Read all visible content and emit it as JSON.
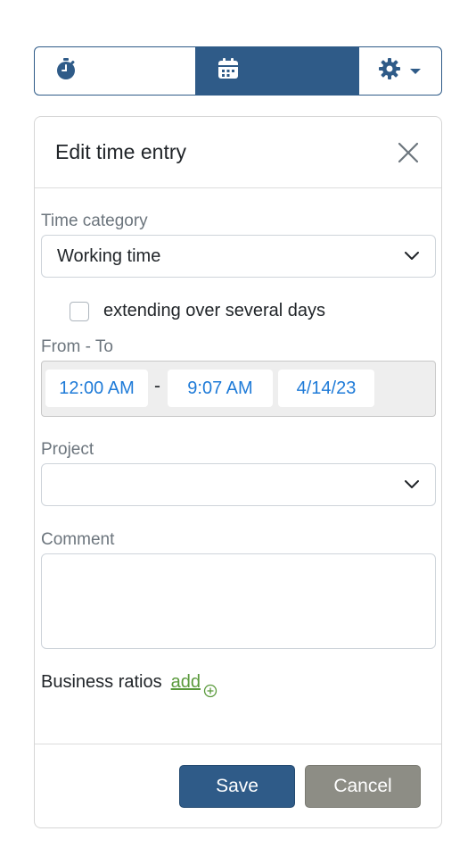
{
  "toolbar": {
    "icons": [
      "stopwatch-icon",
      "calendar-icon",
      "gear-icon",
      "caret-down-icon"
    ]
  },
  "dialog": {
    "title": "Edit time entry",
    "time_category": {
      "label": "Time category",
      "value": "Working time"
    },
    "multi_day": {
      "label": "extending over several days",
      "checked": false
    },
    "from_to": {
      "label": "From - To",
      "start_time": "12:00 AM",
      "separator": "-",
      "end_time": "9:07 AM",
      "date": "4/14/23"
    },
    "project": {
      "label": "Project",
      "value": ""
    },
    "comment": {
      "label": "Comment",
      "value": ""
    },
    "business_ratios": {
      "label": "Business ratios",
      "add_label": "add"
    },
    "save_label": "Save",
    "cancel_label": "Cancel"
  },
  "colors": {
    "primary": "#2f5b88",
    "link_blue": "#1f7bd8",
    "link_green": "#5a9a3c",
    "cancel_gray": "#8d8d85"
  }
}
